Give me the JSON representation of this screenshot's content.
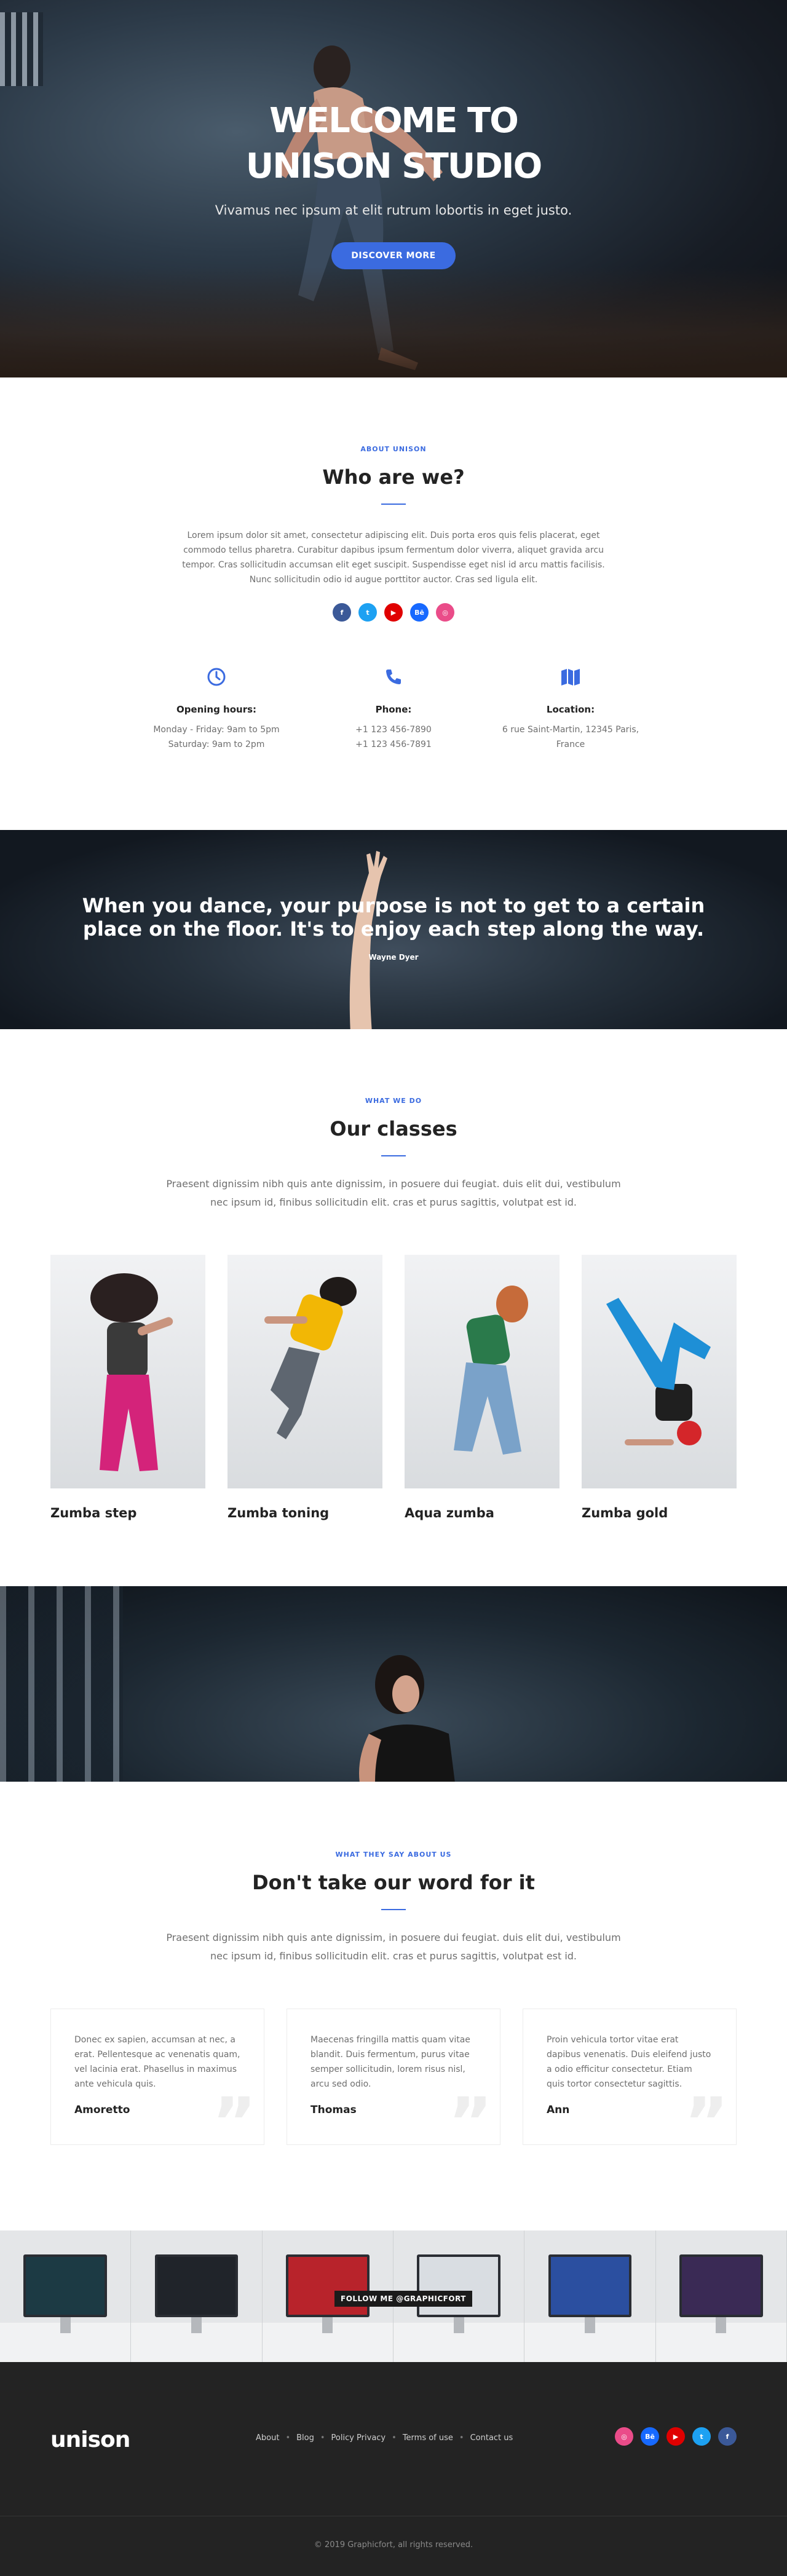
{
  "hero": {
    "title_line1": "WELCOME TO",
    "title_line2": "UNISON STUDIO",
    "subtitle": "Vivamus nec ipsum at elit rutrum lobortis in eget justo.",
    "button": "DISCOVER MORE"
  },
  "about": {
    "eyebrow": "ABOUT UNISON",
    "heading": "Who are we?",
    "text": "Lorem ipsum dolor sit amet, consectetur adipiscing elit. Duis porta eros quis felis placerat, eget commodo tellus pharetra. Curabitur dapibus ipsum fermentum dolor viverra, aliquet gravida arcu tempor. Cras sollicitudin accumsan elit eget suscipit. Suspendisse eget nisl id arcu mattis facilisis. Nunc sollicitudin odio id augue porttitor auctor. Cras sed ligula elit.",
    "social": [
      {
        "icon": "facebook-icon",
        "glyph": "f",
        "color": "#3b5998"
      },
      {
        "icon": "twitter-icon",
        "glyph": "t",
        "color": "#1da1f2"
      },
      {
        "icon": "youtube-icon",
        "glyph": "▶",
        "color": "#e00000"
      },
      {
        "icon": "behance-icon",
        "glyph": "Bē",
        "color": "#1769ff"
      },
      {
        "icon": "dribbble-icon",
        "glyph": "◎",
        "color": "#ea4c89"
      }
    ],
    "info": [
      {
        "icon": "clock-icon",
        "title": "Opening hours:",
        "line1": "Monday - Friday: 9am to 5pm",
        "line2": "Saturday: 9am to 2pm"
      },
      {
        "icon": "phone-icon",
        "title": "Phone:",
        "line1": "+1 123 456-7890",
        "line2": "+1 123 456-7891"
      },
      {
        "icon": "map-icon",
        "title": "Location:",
        "line1": "6 rue Saint-Martin, 12345 Paris,",
        "line2": "France"
      }
    ]
  },
  "quote": {
    "text": "When you dance, your purpose is not to get to a certain place on the floor. It's to enjoy each step along the way.",
    "author": "Wayne Dyer"
  },
  "classes": {
    "eyebrow": "WHAT WE DO",
    "heading": "Our classes",
    "lead": "Praesent dignissim nibh quis ante dignissim, in posuere dui feugiat. duis elit dui, vestibulum nec ipsum id, finibus sollicitudin elit. cras et purus sagittis, volutpat est id.",
    "items": [
      {
        "name": "Zumba step",
        "top": "#3a3a3a",
        "pants": "#d4237a"
      },
      {
        "name": "Zumba toning",
        "top": "#f2b705",
        "pants": "#5e6670"
      },
      {
        "name": "Aqua zumba",
        "top": "#2a7a4b",
        "pants": "#7aa2c9"
      },
      {
        "name": "Zumba gold",
        "top": "#1f1f1f",
        "pants": "#1e8fd6"
      }
    ]
  },
  "testimonials": {
    "eyebrow": "WHAT THEY SAY ABOUT US",
    "heading": "Don't take our word for it",
    "lead": "Praesent dignissim nibh quis ante dignissim, in posuere dui feugiat. duis elit dui, vestibulum nec ipsum id, finibus sollicitudin elit. cras et purus sagittis, volutpat est id.",
    "items": [
      {
        "text": "Donec ex sapien, accumsan at nec, a erat. Pellentesque ac venenatis quam, vel lacinia erat. Phasellus in maximus ante vehicula quis.",
        "name": "Amoretto"
      },
      {
        "text": "Maecenas fringilla mattis quam vitae blandit. Duis fermentum, purus vitae semper sollicitudin, lorem risus nisl, arcu sed odio.",
        "name": "Thomas"
      },
      {
        "text": "Proin vehicula tortor vitae erat dapibus venenatis. Duis eleifend justo a odio efficitur consectetur. Etiam quis tortor consectetur sagittis.",
        "name": "Ann"
      }
    ]
  },
  "gallery": {
    "follow": "FOLLOW ME @GRAPHICFORT"
  },
  "footer": {
    "logo": "unison",
    "nav": [
      "About",
      "Blog",
      "Policy Privacy",
      "Terms of use",
      "Contact us"
    ],
    "social": [
      {
        "icon": "dribbble-icon",
        "glyph": "◎",
        "color": "#ea4c89"
      },
      {
        "icon": "behance-icon",
        "glyph": "Bē",
        "color": "#1769ff"
      },
      {
        "icon": "youtube-icon",
        "glyph": "▶",
        "color": "#e00000"
      },
      {
        "icon": "twitter-icon",
        "glyph": "t",
        "color": "#1da1f2"
      },
      {
        "icon": "facebook-icon",
        "glyph": "f",
        "color": "#3b5998"
      }
    ],
    "copyright": "© 2019 Graphicfort, all rights reserved."
  }
}
